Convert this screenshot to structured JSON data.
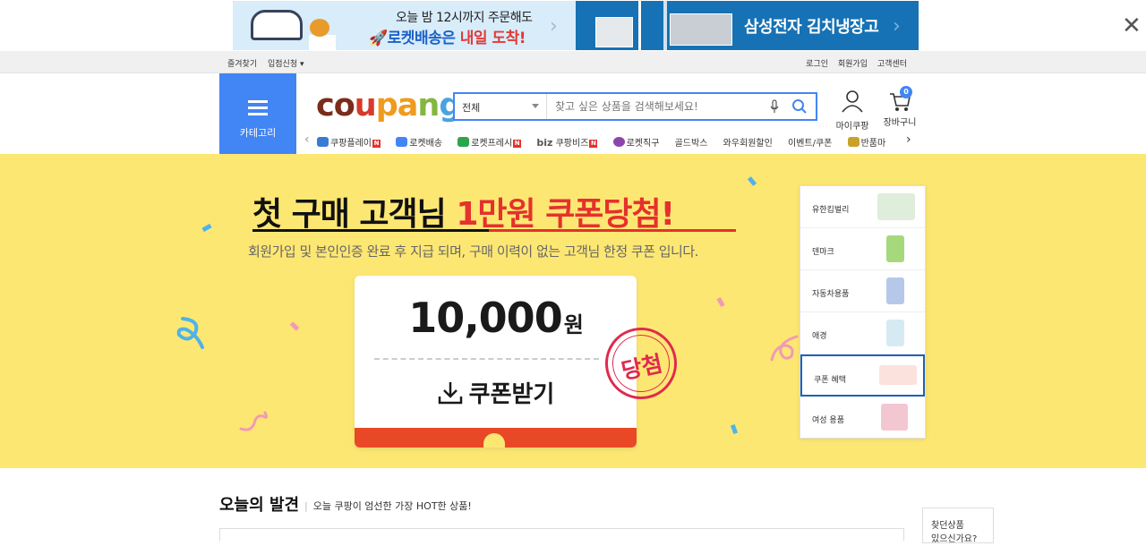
{
  "top_ad": {
    "left_line1": "오늘 밤 12시까지 주문해도",
    "left_line2_a": "🚀로켓배송은 ",
    "left_line2_b": "내일 도착!",
    "right_text": "삼성전자 김치냉장고",
    "arrow": "›",
    "close": "✕"
  },
  "util_bar": {
    "left": [
      "즐겨찾기",
      "입점신청 ▾"
    ],
    "right": [
      "로그인",
      "회원가입",
      "고객센터"
    ]
  },
  "header": {
    "category_label": "카테고리",
    "logo": [
      "c",
      "o",
      "u",
      "p",
      "a",
      "n",
      "g"
    ],
    "search_select": "전체",
    "search_placeholder": "찾고 싶은 상품을 검색해보세요!",
    "mycoupang": "마이쿠팡",
    "cart": "장바구니",
    "cart_count": "0"
  },
  "gnb": {
    "prev": "‹",
    "next": "›",
    "items": [
      {
        "label": "쿠팡플레이",
        "new": "N",
        "color": "#3a7bd5"
      },
      {
        "label": "로켓배송",
        "new": "",
        "color": "#4285f4"
      },
      {
        "label": "로켓프레시",
        "new": "N",
        "color": "#2da44e"
      },
      {
        "label": "쿠팡비즈",
        "prefix": "biz",
        "new": "N",
        "color": ""
      },
      {
        "label": "로켓직구",
        "new": "",
        "color": "#8e44ad"
      },
      {
        "label": "골드박스",
        "new": "",
        "color": ""
      },
      {
        "label": "와우회원할인",
        "new": "",
        "color": ""
      },
      {
        "label": "이벤트/쿠폰",
        "new": "",
        "color": ""
      },
      {
        "label": "반품마",
        "new": "",
        "color": "#c9a227"
      }
    ]
  },
  "banner": {
    "title_a": "첫 구매 고객님 ",
    "title_b": "1만원 쿠폰당첨!",
    "subtitle": "회원가입 및 본인인증 완료 후 지급 되며, 구매 이력이 없는 고객님 한정 쿠폰 입니다.",
    "coupon_amount": "10,000",
    "coupon_unit": "원",
    "download_label": "쿠폰받기",
    "stamp": "당첨"
  },
  "side_menu": [
    {
      "label": "유한킴벌리",
      "color": "#dfeeda",
      "active": false
    },
    {
      "label": "덴마크",
      "color": "#a5d97c",
      "active": false
    },
    {
      "label": "자동차용품",
      "color": "#b6c8ea",
      "active": false
    },
    {
      "label": "애경",
      "color": "#d6eaf3",
      "active": false
    },
    {
      "label": "쿠폰 혜택",
      "color": "#fbe2dc",
      "active": true
    },
    {
      "label": "여성 용품",
      "color": "#f3c7d2",
      "active": false
    }
  ],
  "discover": {
    "title": "오늘의 발견",
    "sep": "|",
    "subtitle": "오늘 쿠팡이 엄선한 가장 HOT한 상품!"
  },
  "recent": "찾던상품\n있으신가요?",
  "colors": {
    "brand_blue": "#4285f4",
    "banner_yellow": "#fde773",
    "accent_red": "#e5312d"
  }
}
